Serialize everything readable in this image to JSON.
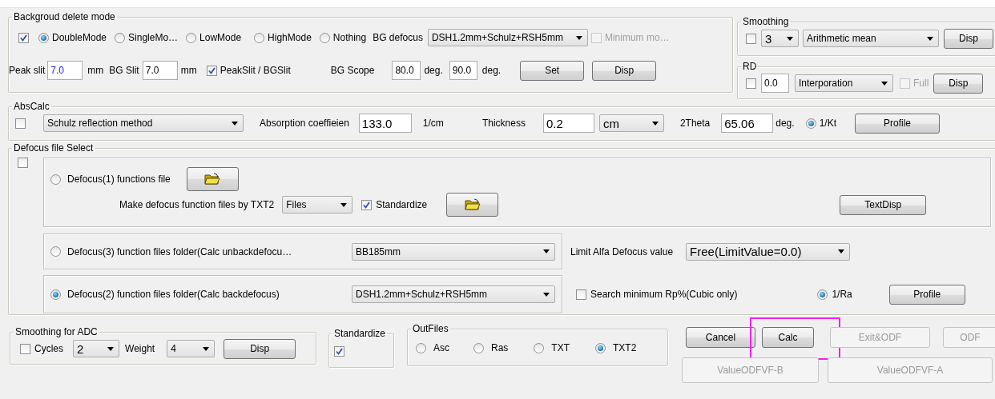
{
  "background_delete": {
    "title": "Backgroud delete mode",
    "enabled": true,
    "modes": [
      {
        "label": "DoubleMode",
        "selected": true
      },
      {
        "label": "SingleMo…",
        "selected": false
      },
      {
        "label": "LowMode",
        "selected": false
      },
      {
        "label": "HighMode",
        "selected": false
      },
      {
        "label": "Nothing",
        "selected": false
      }
    ],
    "bg_defocus_label": "BG defocus",
    "bg_defocus": "DSH1.2mm+Schulz+RSH5mm",
    "minimum_mode": {
      "label": "Minimum mo…",
      "checked": false,
      "disabled": true
    },
    "peak_slit": {
      "label": "Peak slit",
      "value": "7.0",
      "unit": "mm"
    },
    "bg_slit": {
      "label": "BG Slit",
      "value": "7.0",
      "unit": "mm"
    },
    "slit_ratio": {
      "label": "PeakSlit / BGSlit",
      "checked": true
    },
    "bg_scope": {
      "label": "BG Scope",
      "from": "80.0",
      "from_unit": "deg.",
      "to": "90.0",
      "to_unit": "deg."
    },
    "buttons": [
      "Set",
      "Disp"
    ]
  },
  "smoothing": {
    "title": "Smoothing",
    "enabled": false,
    "points": "3",
    "method": "Arithmetic mean",
    "button": "Disp"
  },
  "rd": {
    "title": "RD",
    "enabled": false,
    "value": "0.0",
    "method": "Interporation",
    "full": {
      "label": "Full",
      "checked": false,
      "disabled": true
    },
    "button": "Disp"
  },
  "abs_calc": {
    "title": "AbsCalc",
    "enabled": false,
    "method": "Schulz reflection method",
    "coefficient_label": "Absorption coeffieien",
    "coefficient": "133.0",
    "coefficient_unit": "1/cm",
    "thickness_label": "Thickness",
    "thickness": "0.2",
    "thickness_unit": "cm",
    "two_theta_label": "2Theta",
    "two_theta": "65.06",
    "two_theta_unit": "deg.",
    "kt": {
      "label": "1/Kt",
      "selected": true
    },
    "button": "Profile"
  },
  "defocus_select": {
    "title": "Defocus file Select",
    "enabled": false,
    "sources": [
      {
        "kind": "file",
        "label": "Defocus(1) functions file",
        "selected": false
      },
      {
        "kind": "folder",
        "label": "Defocus(3) function files folder(Calc unbackdefocu…",
        "selected": false,
        "folder": "BB185mm"
      },
      {
        "kind": "folder",
        "label": "Defocus(2) function files folder(Calc backdefocus)",
        "selected": true,
        "folder": "DSH1.2mm+Schulz+RSH5mm"
      }
    ],
    "make_label": "Make defocus function files by TXT2",
    "make_type": "Files",
    "standardize": {
      "label": "Standardize",
      "checked": true
    },
    "text_button": "TextDisp",
    "limit_label": "Limit Alfa Defocus value",
    "limit": "Free(LimitValue=0.0)",
    "search_min": {
      "label": "Search minimum Rp%(Cubic only)",
      "checked": false
    },
    "ra": {
      "label": "1/Ra",
      "selected": true
    },
    "profile_button": "Profile"
  },
  "smoothing_adc": {
    "title": "Smoothing for ADC",
    "cycles": {
      "label": "Cycles",
      "checked": false
    },
    "cycles_value": "2",
    "weight_label": "Weight",
    "weight": "4",
    "button": "Disp"
  },
  "standardize": {
    "title": "Standardize",
    "checked": true
  },
  "out_files": {
    "title": "OutFiles",
    "formats": [
      {
        "label": "Asc",
        "selected": false
      },
      {
        "label": "Ras",
        "selected": false
      },
      {
        "label": "TXT",
        "selected": false
      },
      {
        "label": "TXT2",
        "selected": true
      }
    ]
  },
  "action_rows": [
    [
      {
        "label": "Cancel",
        "disabled": false,
        "highlighted": false
      },
      {
        "label": "Calc",
        "disabled": false,
        "highlighted": true
      },
      {
        "label": "Exit&ODF",
        "disabled": true,
        "highlighted": false
      },
      {
        "label": "ODF",
        "disabled": true,
        "highlighted": false
      }
    ],
    [
      {
        "label": "ValueODFVF-B",
        "disabled": true,
        "highlighted": false
      },
      {
        "label": "ValueODFVF-A",
        "disabled": true,
        "highlighted": false
      }
    ]
  ]
}
